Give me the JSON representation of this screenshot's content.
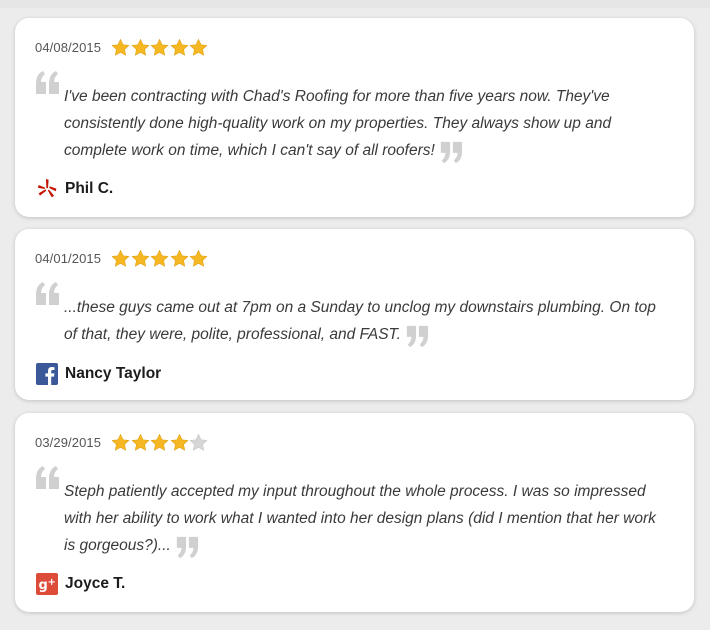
{
  "reviews": [
    {
      "date": "04/08/2015",
      "rating": 5,
      "text": "I've been contracting with Chad's Roofing for more than five years now. They've consistently done high-quality work on my properties. They always show up and complete work on time, which I can't say of all roofers!",
      "author": "Phil C.",
      "source_icon": "yelp-icon"
    },
    {
      "date": "04/01/2015",
      "rating": 5,
      "text": "...these guys came out at 7pm on a Sunday to unclog my downstairs plumbing. On top of that, they were, polite, professional, and FAST.",
      "author": "Nancy Taylor",
      "source_icon": "facebook-icon"
    },
    {
      "date": "03/29/2015",
      "rating": 4,
      "text": "Steph patiently accepted my input throughout the whole process. I was so impressed with her ability to work what I wanted into her design plans (did I mention that her work is gorgeous?)...",
      "author": "Joyce T.",
      "source_icon": "google-plus-icon"
    }
  ],
  "colors": {
    "star_filled": "#f5b823",
    "star_empty": "#d6d6d6",
    "quote_mark": "#d0d0d0",
    "yelp": "#c41200",
    "facebook": "#3b5998",
    "google_plus": "#dd4b39"
  }
}
